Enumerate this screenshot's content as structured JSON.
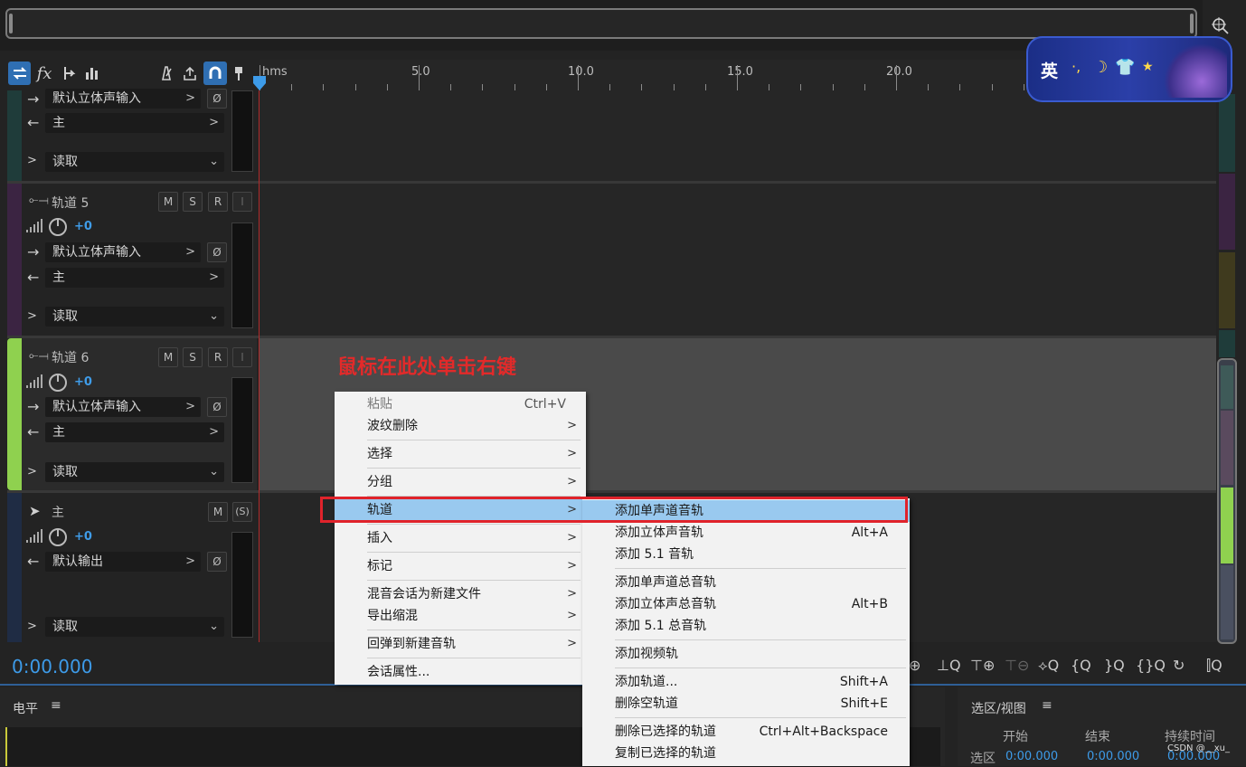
{
  "toolbar": {
    "fx_label": "fx"
  },
  "ruler": {
    "unit": "hms",
    "marks": [
      "5.0",
      "10.0",
      "15.0",
      "20.0"
    ]
  },
  "tracks": [
    {
      "name": "",
      "input": "默认立体声输入",
      "output": "主",
      "automation": "读取"
    },
    {
      "name": "轨道 5",
      "volume": "+0",
      "input": "默认立体声输入",
      "output": "主",
      "automation": "读取",
      "btn_m": "M",
      "btn_s": "S",
      "btn_r": "R",
      "btn_i": "I"
    },
    {
      "name": "轨道 6",
      "volume": "+0",
      "input": "默认立体声输入",
      "output": "主",
      "automation": "读取",
      "btn_m": "M",
      "btn_s": "S",
      "btn_r": "R",
      "btn_i": "I"
    },
    {
      "name": "主",
      "volume": "+0",
      "output": "默认输出",
      "automation": "读取",
      "btn_m": "M",
      "btn_s": "(S)"
    }
  ],
  "annotation": "鼠标在此处单击右键",
  "context_menu": {
    "items": [
      {
        "label": "粘贴",
        "shortcut": "Ctrl+V"
      },
      {
        "label": "波纹删除"
      },
      {
        "label": "选择"
      },
      {
        "label": "分组"
      },
      {
        "label": "轨道"
      },
      {
        "label": "插入"
      },
      {
        "label": "标记"
      },
      {
        "label": "混音会话为新建文件"
      },
      {
        "label": "导出缩混"
      },
      {
        "label": "回弹到新建音轨"
      },
      {
        "label": "会话属性..."
      }
    ]
  },
  "submenu": {
    "items": [
      {
        "label": "添加单声道音轨",
        "shortcut": ""
      },
      {
        "label": "添加立体声音轨",
        "shortcut": "Alt+A"
      },
      {
        "label": "添加 5.1 音轨",
        "shortcut": ""
      },
      {
        "label": "添加单声道总音轨",
        "shortcut": ""
      },
      {
        "label": "添加立体声总音轨",
        "shortcut": "Alt+B"
      },
      {
        "label": "添加 5.1 总音轨",
        "shortcut": ""
      },
      {
        "label": "添加视频轨",
        "shortcut": ""
      },
      {
        "label": "添加轨道...",
        "shortcut": "Shift+A"
      },
      {
        "label": "删除空轨道",
        "shortcut": "Shift+E"
      },
      {
        "label": "删除已选择的轨道",
        "shortcut": "Ctrl+Alt+Backspace"
      },
      {
        "label": "复制已选择的轨道",
        "shortcut": ""
      }
    ]
  },
  "timecode": "0:00.000",
  "levels_panel": {
    "title": "电平"
  },
  "selection_panel": {
    "title": "选区/视图",
    "col_start": "开始",
    "col_end": "结束",
    "col_duration": "持续时间",
    "row_label": "选区",
    "start": "0:00.000",
    "end": "0:00.000",
    "duration": "0:00.000"
  },
  "ime_badge": {
    "label": "英"
  },
  "watermark": "CSDN @__xu_",
  "colors": {
    "accent": "#3d9be9",
    "highlight": "#99c9ef",
    "annotation": "#e22a2a",
    "track6": "#8fd14f",
    "track5": "#5a2f66"
  }
}
